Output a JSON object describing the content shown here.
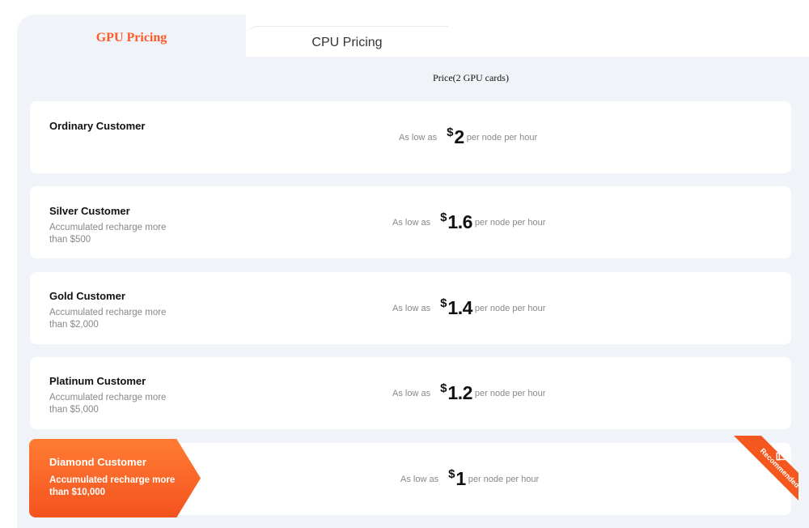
{
  "tabs": [
    {
      "label": "GPU Pricing",
      "active": true
    },
    {
      "label": "CPU Pricing",
      "active": false
    }
  ],
  "price_header": "Price(2 GPU cards)",
  "tiers": [
    {
      "name": "Ordinary Customer",
      "desc": "",
      "lead": "As low as",
      "currency": "$",
      "amount": "2",
      "tail": "per node per hour"
    },
    {
      "name": "Silver Customer",
      "desc": "Accumulated recharge more than $500",
      "lead": "As low as",
      "currency": "$",
      "amount": "1.6",
      "tail": "per node per hour"
    },
    {
      "name": "Gold Customer",
      "desc": "Accumulated recharge more than $2,000",
      "lead": "As low as",
      "currency": "$",
      "amount": "1.4",
      "tail": "per node per hour"
    },
    {
      "name": "Platinum Customer",
      "desc": "Accumulated recharge more than $5,000",
      "lead": "As low as",
      "currency": "$",
      "amount": "1.2",
      "tail": "per node per hour"
    },
    {
      "name": "Diamond Customer",
      "desc": "Accumulated recharge more than $10,000",
      "lead": "As low as",
      "currency": "$",
      "amount": "1",
      "tail": "per node per hour"
    }
  ],
  "recommended_label": "Recommended",
  "icons": {
    "recommended": "thumbs-up-icon"
  },
  "colors": {
    "accent": "#ff5a24",
    "panel_bg": "#f0f3f8"
  }
}
